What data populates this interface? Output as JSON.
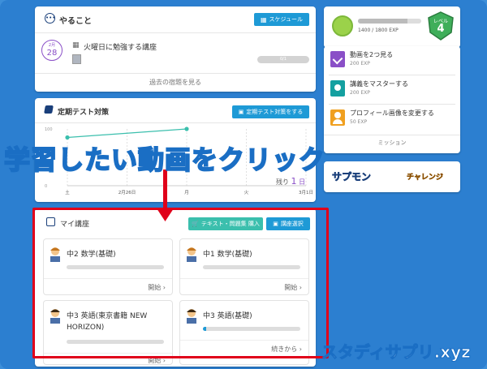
{
  "todo": {
    "title": "やること",
    "schedule_button": "スケジュール",
    "date_month": "2月",
    "date_day": "28",
    "task_title": "火曜日に勉強する講座",
    "progress_text": "0/1",
    "past_tasks_link": "過去の宿題を見る"
  },
  "exam": {
    "title": "定期テスト対策",
    "button": "定期テスト対策をする",
    "remaining_prefix": "残り",
    "remaining_days": "1",
    "remaining_suffix": "日"
  },
  "chart_data": {
    "type": "line",
    "x": [
      "土",
      "2月26日",
      "月",
      "火",
      "3月1日"
    ],
    "series": [
      {
        "values": [
          85,
          null,
          100,
          null,
          null
        ]
      }
    ],
    "yticks": [
      "100",
      "0"
    ],
    "ylim": [
      0,
      100
    ]
  },
  "profile": {
    "exp_text": "1400 / 1800 EXP",
    "level_label": "レベル",
    "level_value": "4"
  },
  "missions": {
    "items": [
      {
        "title": "動画を2つ見る",
        "exp": "200 EXP"
      },
      {
        "title": "講義をマスターする",
        "exp": "200 EXP"
      },
      {
        "title": "プロフィール画像を変更する",
        "exp": "50 EXP"
      }
    ],
    "footer": "ミッション"
  },
  "banners": {
    "left": "サプモン",
    "right": "チャレンジ"
  },
  "courses": {
    "title": "マイ講座",
    "buy_button": "テキスト・問題集 購入",
    "select_button": "講座選択",
    "items": [
      {
        "title": "中2 数学(基礎)",
        "action": "開始",
        "progress": 0
      },
      {
        "title": "中1 数学(基礎)",
        "action": "開始",
        "progress": 0
      },
      {
        "title": "中3 英語(東京書籍 NEW HORIZON)",
        "action": "開始",
        "progress": 0
      },
      {
        "title": "中3 英語(基礎)",
        "action": "続きから",
        "progress": 0.03
      }
    ]
  },
  "overlay": {
    "caption": "学習したい動画をクリック",
    "watermark": "スタディサプリ.xyz"
  },
  "colors": {
    "background": "#2c7fd0",
    "accent": "#1e9ad6",
    "teal": "#3bbfad",
    "highlight": "#e0001a",
    "date_circle": "#8a4fc7"
  }
}
